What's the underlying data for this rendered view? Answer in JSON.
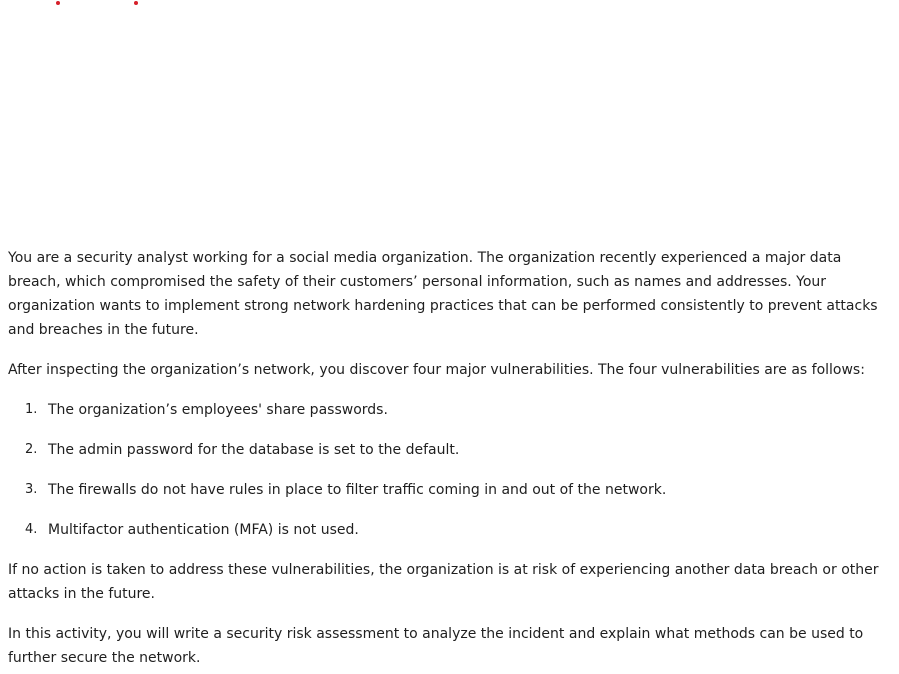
{
  "colors": {
    "text": "#1f1f1f",
    "accent_dot": "#d6202a",
    "background": "#ffffff"
  },
  "article": {
    "intro": "You are a security analyst working for a social media organization. The organization recently experienced a major data breach, which compromised the safety of their customers’ personal information, such as names and addresses. Your organization wants to implement strong network hardening practices that can be performed consistently to prevent attacks and breaches in the future.",
    "discovery": "After inspecting the organization’s network, you discover four major vulnerabilities. The four vulnerabilities are as follows:",
    "vulnerabilities": [
      {
        "number": "1.",
        "text": "The organization’s employees' share passwords."
      },
      {
        "number": "2.",
        "text": "The admin password for the database is set to the default."
      },
      {
        "number": "3.",
        "text": "The firewalls do not have rules in place to filter traffic coming in and out of the network."
      },
      {
        "number": "4.",
        "text": "Multifactor authentication (MFA) is not used."
      }
    ],
    "risk": "If no action is taken to address these vulnerabilities, the organization is at risk of experiencing another data breach or other attacks in the future.",
    "activity": "In this activity, you will write a security risk assessment to analyze the incident and explain what methods can be used to further secure the network."
  }
}
